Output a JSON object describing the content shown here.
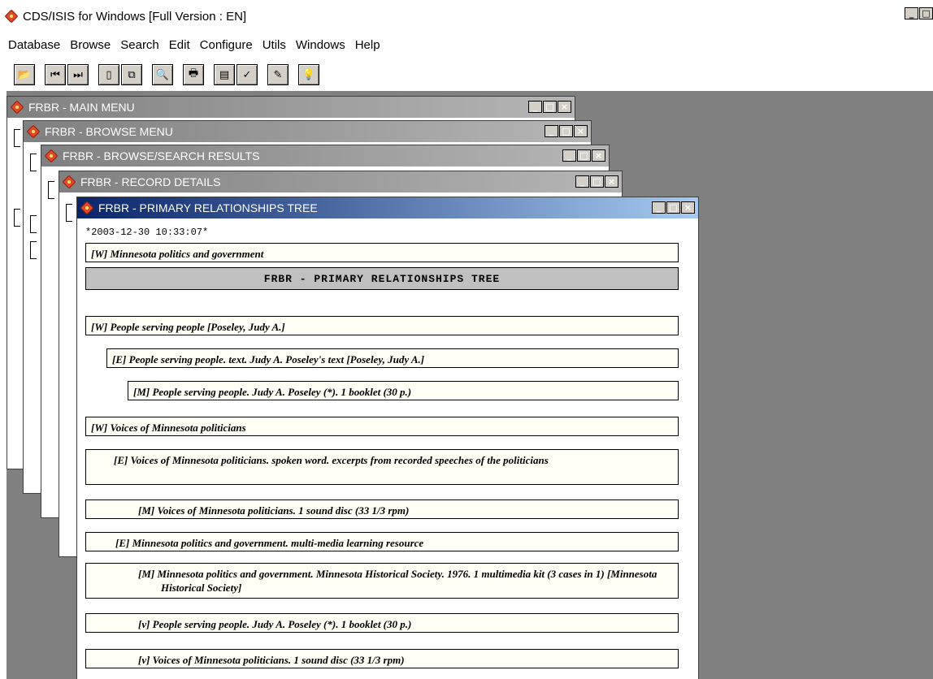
{
  "app": {
    "title": "CDS/ISIS for Windows [Full Version : EN]",
    "minimize": "_",
    "maximize": "□"
  },
  "menu": [
    "Database",
    "Browse",
    "Search",
    "Edit",
    "Configure",
    "Utils",
    "Windows",
    "Help"
  ],
  "toolbar": {
    "groups": [
      [
        "open-icon"
      ],
      [
        "first-record-icon",
        "last-record-icon"
      ],
      [
        "clipboard-icon",
        "copy-record-icon"
      ],
      [
        "preview-icon"
      ],
      [
        "print-icon"
      ],
      [
        "form-icon",
        "check-icon"
      ],
      [
        "edit-pen-icon"
      ],
      [
        "lightbulb-icon"
      ]
    ]
  },
  "windows": {
    "main_menu": "FRBR - MAIN MENU",
    "browse_menu": "FRBR - BROWSE MENU",
    "results": "FRBR - BROWSE/SEARCH RESULTS",
    "record_details": "FRBR - RECORD DETAILS",
    "tree": "FRBR - PRIMARY RELATIONSHIPS TREE",
    "btn_min": "_",
    "btn_max": "□",
    "btn_close": "×"
  },
  "tree": {
    "timestamp": "*2003-12-30  10:33:07*",
    "header_record": "[W] Minnesota politics and government",
    "banner": "FRBR  -  PRIMARY RELATIONSHIPS TREE",
    "records": [
      "[W] People serving people [Poseley, Judy A.]",
      "[E] People serving people. text. Judy A. Poseley's text [Poseley, Judy A.]",
      "[M] People serving people. Judy A. Poseley (*). 1 booklet (30 p.)",
      "[W] Voices of Minnesota politicians",
      "[E] Voices of Minnesota politicians. spoken word. excerpts from recorded speeches of the politicians",
      "[M] Voices of Minnesota politicians. 1 sound disc (33 1/3 rpm)",
      "[E] Minnesota politics and government. multi-media learning resource",
      "[M] Minnesota politics and government. Minnesota Historical Society. 1976. 1 multimedia kit (3 cases in 1) [Minnesota Historical Society]",
      "[v] People serving people. Judy A. Poseley (*). 1 booklet (30 p.)",
      "[v] Voices of Minnesota politicians. 1 sound disc (33 1/3 rpm)"
    ]
  }
}
